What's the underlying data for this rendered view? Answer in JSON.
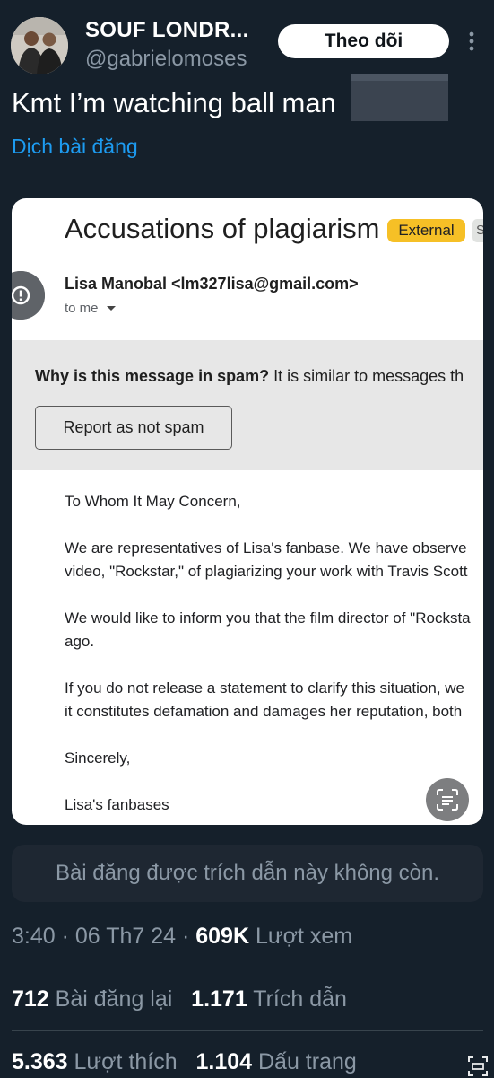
{
  "header": {
    "author_name": "SOUF LONDR...",
    "author_handle": "@gabrielomoses",
    "follow_label": "Theo dõi"
  },
  "tweet": {
    "text": "Kmt I’m watching ball man",
    "translate_label": "Dịch bài đăng"
  },
  "email": {
    "subject": "Accusations of plagiarism",
    "badge_external": "External",
    "badge_cut": "S",
    "sender": "Lisa Manobal <lm327lisa@gmail.com>",
    "to": "to me",
    "spam_question": "Why is this message in spam?",
    "spam_reason": " It is similar to messages th",
    "report_button": "Report as not spam",
    "body": [
      "To Whom It May Concern,",
      "We are representatives of Lisa's fanbase. We have observe",
      "video, \"Rockstar,\" of plagiarizing your work with Travis Scott",
      "We would like to inform you that the film director of \"Rocksta",
      "ago.",
      "If you do not release a statement to clarify this situation, we",
      "it constitutes defamation and damages her reputation, both",
      "Sincerely,",
      "Lisa's fanbases"
    ]
  },
  "quote_unavailable": "Bài đăng được trích dẫn này không còn.",
  "meta": {
    "time": "3:40",
    "date": "06 Th7 24",
    "views_count": "609K",
    "views_label": "Lượt xem"
  },
  "stats": {
    "reposts_count": "712",
    "reposts_label": "Bài đăng lại",
    "quotes_count": "1.171",
    "quotes_label": "Trích dẫn",
    "likes_count": "5.363",
    "likes_label": "Lượt thích",
    "bookmarks_count": "1.104",
    "bookmarks_label": "Dấu trang"
  },
  "colors": {
    "background": "#15202b",
    "link": "#1d9bf0",
    "muted": "#8b98a5",
    "badge": "#f6c026"
  }
}
